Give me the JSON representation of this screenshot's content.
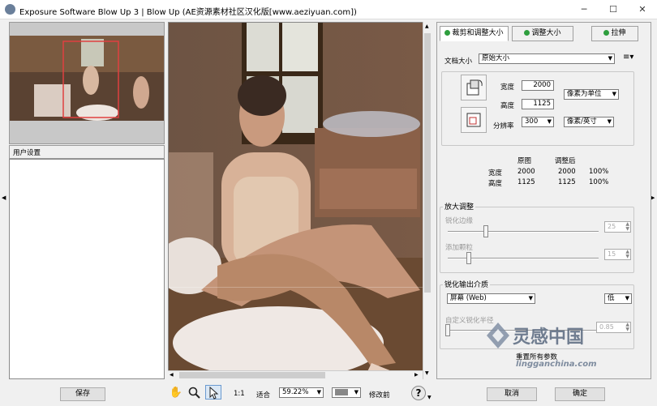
{
  "window": {
    "title": "Exposure Software Blow Up 3 | Blow Up    (AE资源素材社区汉化版[www.aeziyuan.com])",
    "minimize": "─",
    "maximize": "☐",
    "close": "✕"
  },
  "left_panel": {
    "presets_header": "用户设置",
    "save_button": "保存"
  },
  "toolbar": {
    "zoom_1to1": "1:1",
    "fit": "适合",
    "zoom_value": "59.22%",
    "before_after": "修改前",
    "cancel_button": "取消",
    "ok_button": "确定"
  },
  "tabs": [
    {
      "label": "裁剪和调整大小"
    },
    {
      "label": "调整大小"
    },
    {
      "label": "拉伸"
    }
  ],
  "doc": {
    "size_label": "文档大小",
    "size_value": "原始大小",
    "width_label": "宽度",
    "width_value": "2000",
    "height_label": "高度",
    "height_value": "1125",
    "units_value": "像素为单位",
    "res_label": "分辨率",
    "res_value": "300",
    "res_units_value": "像素/英寸"
  },
  "stats": {
    "col_original": "原图",
    "col_adjusted": "调整后",
    "rows": [
      {
        "label": "宽度",
        "original": "2000",
        "adjusted": "2000",
        "pct": "100%"
      },
      {
        "label": "高度",
        "original": "1125",
        "adjusted": "1125",
        "pct": "100%"
      }
    ]
  },
  "enlarge": {
    "title": "放大调整",
    "sharpen_label": "锐化边缘",
    "sharpen_value": "25",
    "grain_label": "添加颗粒",
    "grain_value": "15"
  },
  "output": {
    "title": "锐化输出介质",
    "media_value": "屏幕 (Web)",
    "level_value": "低",
    "custom_label": "自定义锐化半径",
    "custom_value": "0.85",
    "reset_button": "重置所有参数"
  },
  "watermark": {
    "brand": "灵感中国",
    "url": "lingganchina.com"
  },
  "colors": {
    "accent_green": "#2e9e3e",
    "crop_red": "#e04040"
  }
}
